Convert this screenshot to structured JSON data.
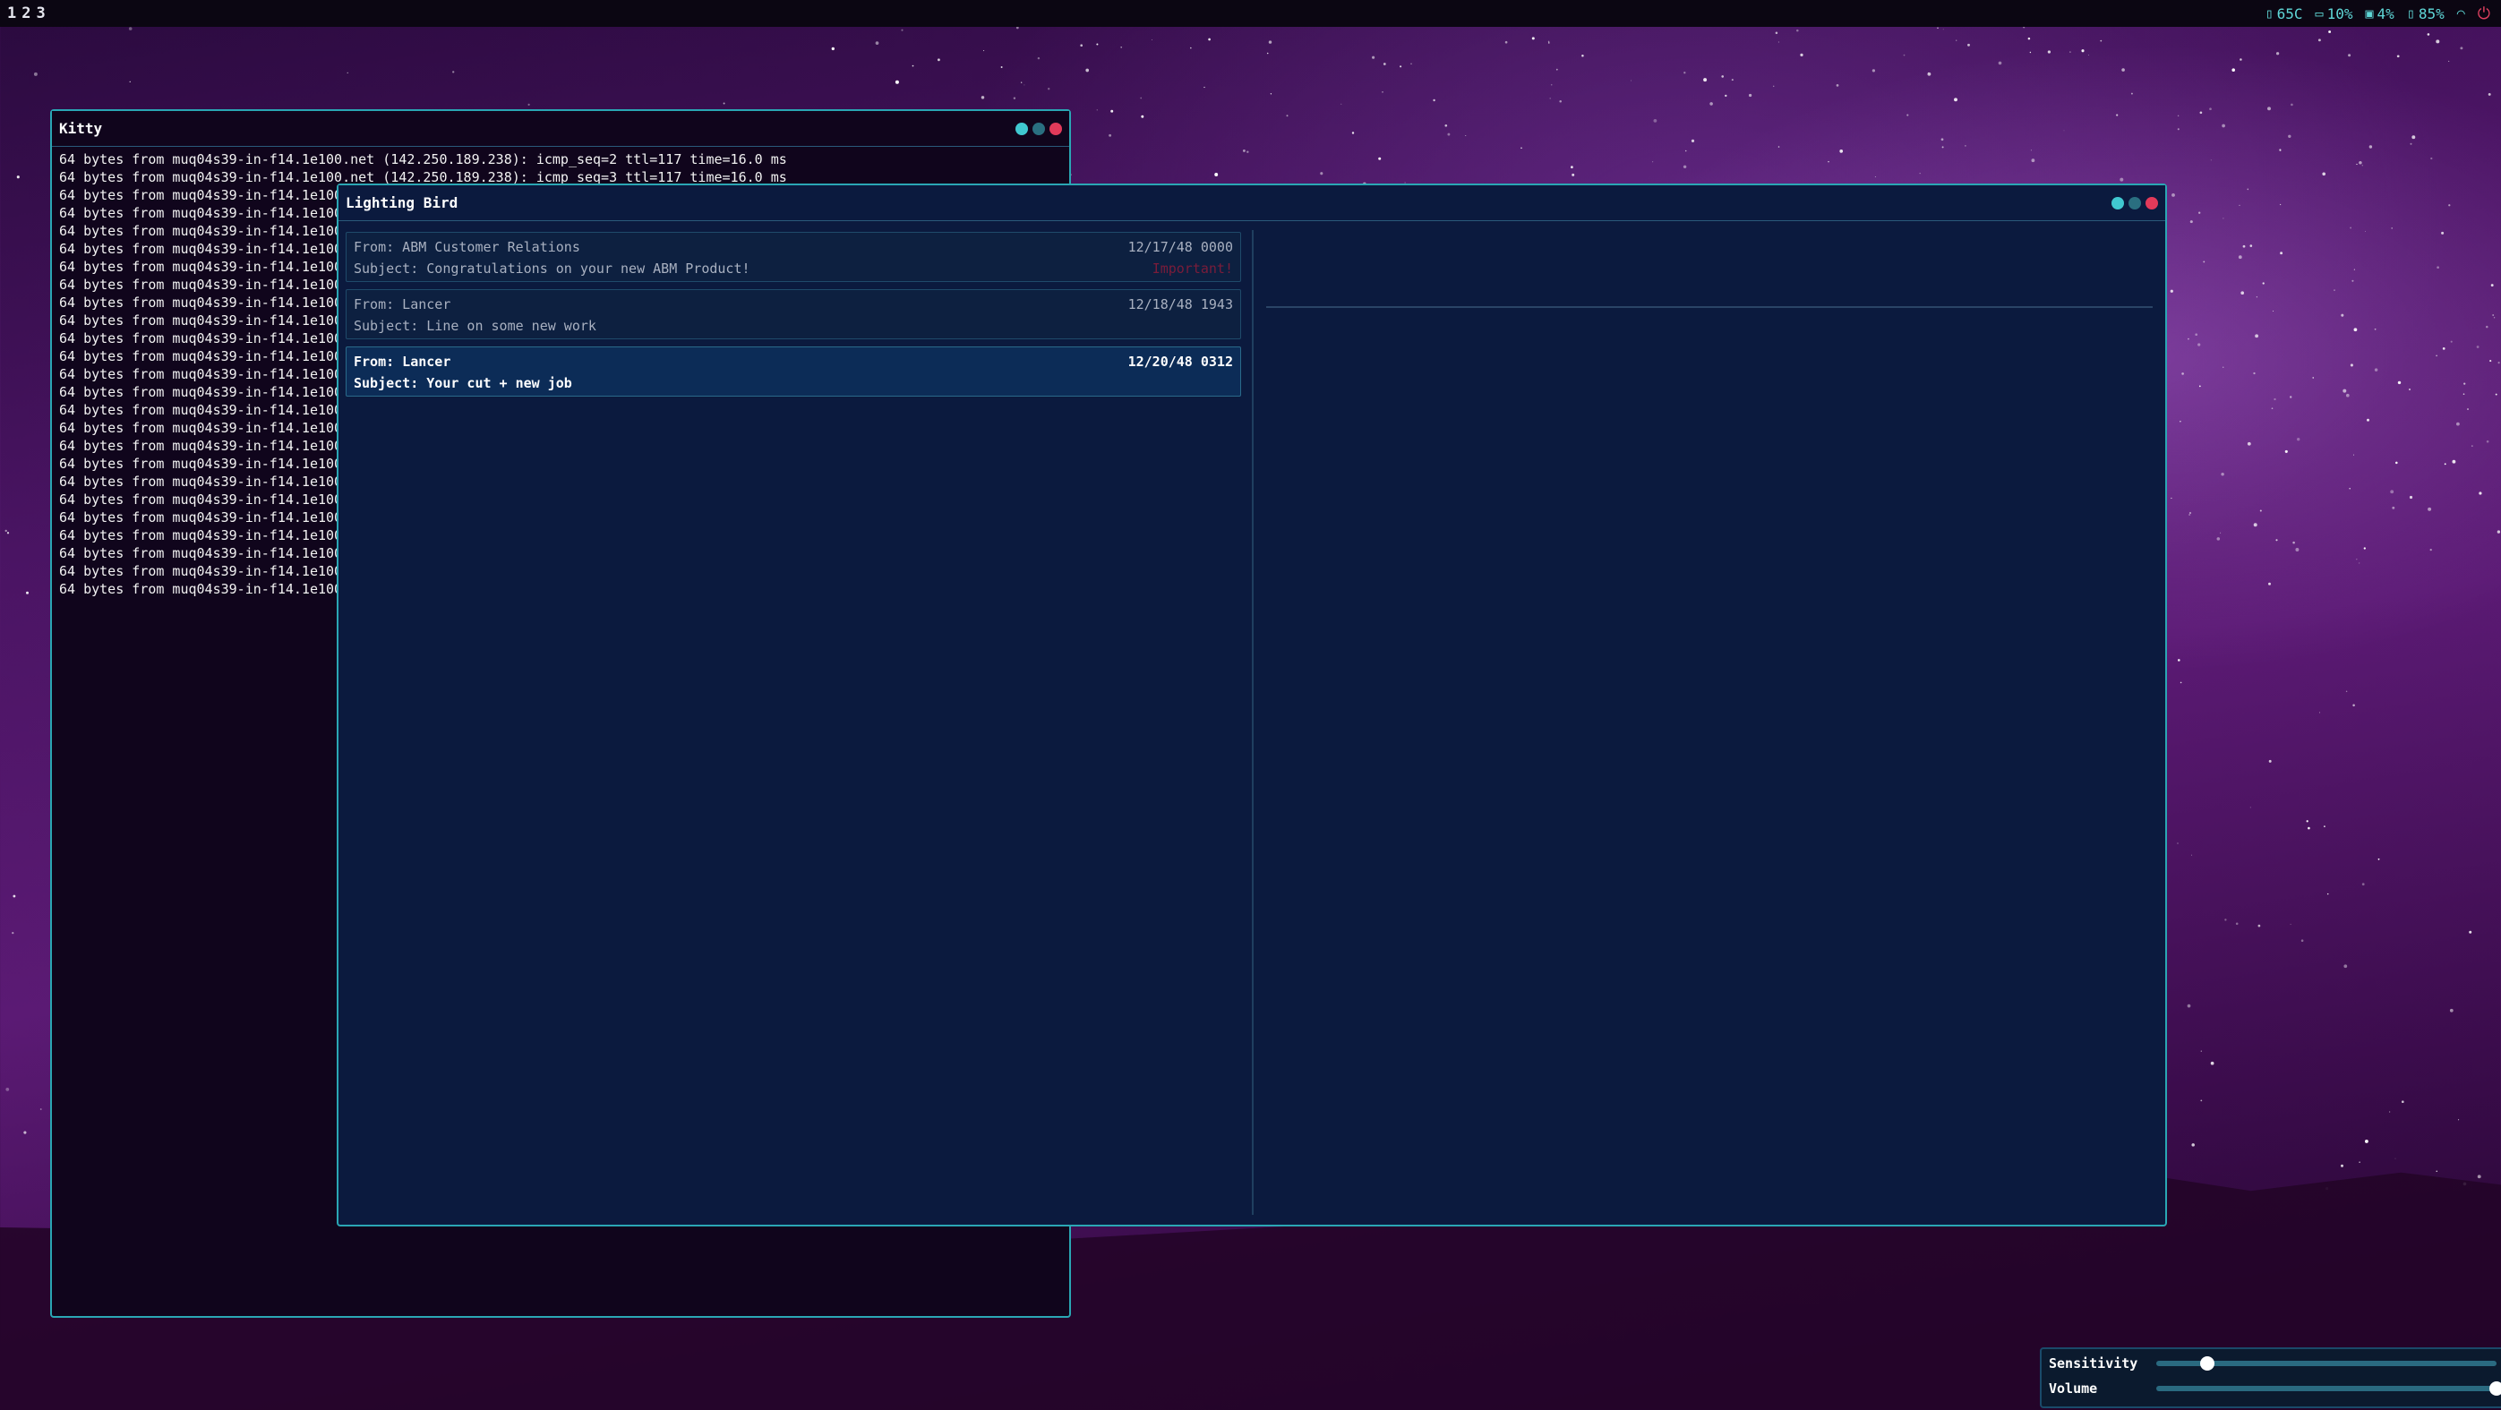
{
  "topbar": {
    "workspaces": [
      "1",
      "2",
      "3"
    ],
    "status": {
      "temp": "65C",
      "cpu": "10%",
      "mem": "4%",
      "battery": "85%"
    }
  },
  "kitty": {
    "title": "Kitty",
    "lines": [
      "64 bytes from muq04s39-in-f14.1e100.net (142.250.189.238): icmp_seq=2 ttl=117 time=16.0 ms",
      "64 bytes from muq04s39-in-f14.1e100.net (142.250.189.238): icmp_seq=3 ttl=117 time=16.0 ms",
      "64 bytes from muq04s39-in-f14.1e100.net",
      "64 bytes from muq04s39-in-f14.1e100.net",
      "64 bytes from muq04s39-in-f14.1e100.net",
      "64 bytes from muq04s39-in-f14.1e100.net",
      "64 bytes from muq04s39-in-f14.1e100.net",
      "64 bytes from muq04s39-in-f14.1e100.net",
      "64 bytes from muq04s39-in-f14.1e100.net",
      "64 bytes from muq04s39-in-f14.1e100.net",
      "64 bytes from muq04s39-in-f14.1e100.net",
      "64 bytes from muq04s39-in-f14.1e100.net",
      "64 bytes from muq04s39-in-f14.1e100.net",
      "64 bytes from muq04s39-in-f14.1e100.net",
      "64 bytes from muq04s39-in-f14.1e100.net",
      "64 bytes from muq04s39-in-f14.1e100.net",
      "64 bytes from muq04s39-in-f14.1e100.net",
      "64 bytes from muq04s39-in-f14.1e100.net",
      "64 bytes from muq04s39-in-f14.1e100.net",
      "64 bytes from muq04s39-in-f14.1e100.net",
      "64 bytes from muq04s39-in-f14.1e100.net",
      "64 bytes from muq04s39-in-f14.1e100.net",
      "64 bytes from muq04s39-in-f14.1e100.net",
      "64 bytes from muq04s39-in-f14.1e100.net",
      "64 bytes from muq04s39-in-f14.1e100.net"
    ]
  },
  "bird": {
    "title": "Lighting Bird",
    "messages": [
      {
        "from": "From: ABM Customer Relations",
        "date": "12/17/48 0000",
        "subject": "Subject: Congratulations on your new ABM Product!",
        "tag": "Important!"
      },
      {
        "from": "From: Lancer",
        "date": "12/18/48  1943",
        "subject": "Subject: Line on some new work",
        "tag": ""
      },
      {
        "from": "From: Lancer",
        "date": "12/20/48  0312",
        "subject": "Subject: Your cut + new job",
        "tag": ""
      }
    ]
  },
  "controls": {
    "sensitivity_label": "Sensitivity",
    "sensitivity_value": 0.15,
    "volume_label": "Volume",
    "volume_value": 1.0
  },
  "colors": {
    "accent": "#2aa7b4",
    "close": "#e23a5a",
    "important": "#7a1c3a"
  }
}
